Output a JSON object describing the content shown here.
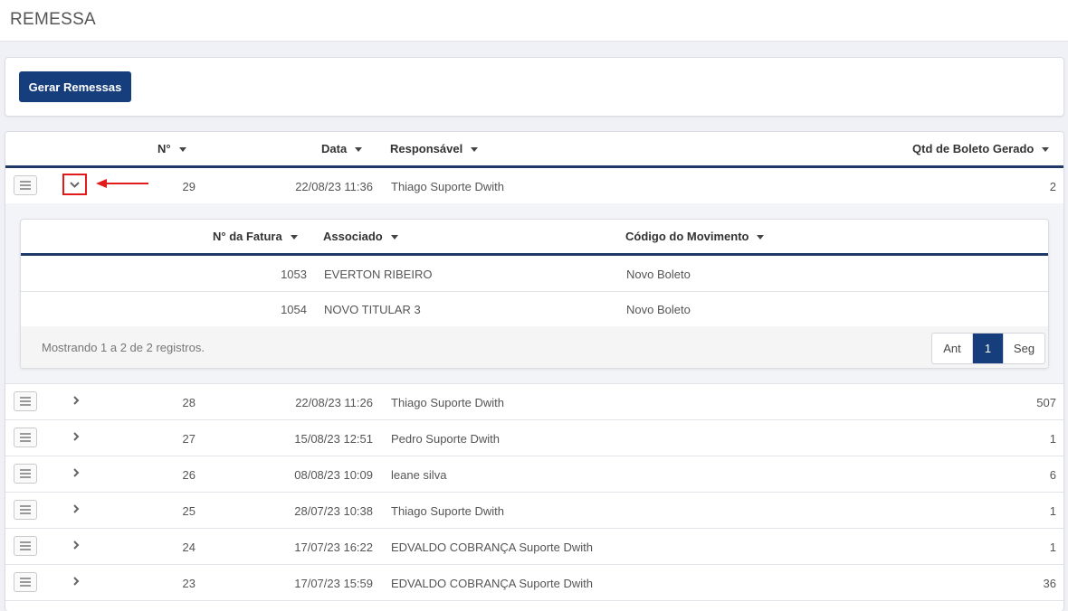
{
  "page": {
    "title": "REMESSA"
  },
  "toolbar": {
    "generate_label": "Gerar Remessas"
  },
  "table": {
    "headers": {
      "num": "N°",
      "date": "Data",
      "responsible": "Responsável",
      "qty": "Qtd de Boleto Gerado"
    },
    "expanded_row": {
      "num": "29",
      "date": "22/08/23 11:36",
      "responsible": "Thiago Suporte Dwith",
      "qty": "2"
    },
    "rows": [
      {
        "num": "28",
        "date": "22/08/23 11:26",
        "responsible": "Thiago Suporte Dwith",
        "qty": "507"
      },
      {
        "num": "27",
        "date": "15/08/23 12:51",
        "responsible": "Pedro Suporte Dwith",
        "qty": "1"
      },
      {
        "num": "26",
        "date": "08/08/23 10:09",
        "responsible": "leane silva",
        "qty": "6"
      },
      {
        "num": "25",
        "date": "28/07/23 10:38",
        "responsible": "Thiago Suporte Dwith",
        "qty": "1"
      },
      {
        "num": "24",
        "date": "17/07/23 16:22",
        "responsible": "EDVALDO COBRANÇA Suporte Dwith",
        "qty": "1"
      },
      {
        "num": "23",
        "date": "17/07/23 15:59",
        "responsible": "EDVALDO COBRANÇA Suporte Dwith",
        "qty": "36"
      }
    ]
  },
  "detail": {
    "headers": {
      "invoice": "N° da Fatura",
      "associate": "Associado",
      "movement": "Código do Movimento"
    },
    "rows": [
      {
        "invoice": "1053",
        "associate": "EVERTON RIBEIRO",
        "movement": "Novo Boleto"
      },
      {
        "invoice": "1054",
        "associate": "NOVO TITULAR 3",
        "movement": "Novo Boleto"
      }
    ],
    "info": "Mostrando 1 a 2 de 2 registros.",
    "pager": {
      "prev": "Ant",
      "current": "1",
      "next": "Seg"
    }
  },
  "icons": {
    "row_menu": "menu-icon",
    "expand": "chevron-right-icon",
    "collapse": "chevron-down-icon",
    "annotation": "arrow-left-icon"
  },
  "colors": {
    "primary": "#173e7c",
    "header_rule": "#1f3a68",
    "annotation": "#e11b1b"
  }
}
